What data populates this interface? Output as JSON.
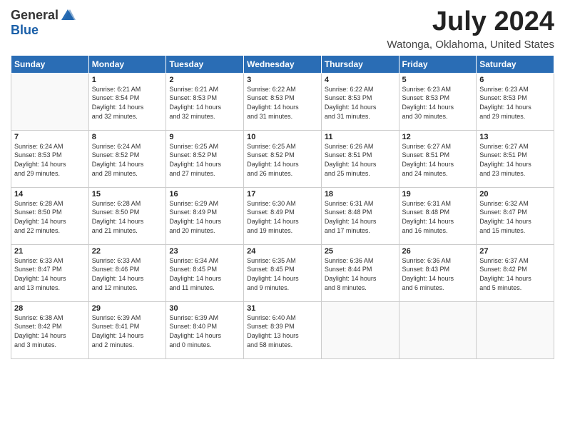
{
  "header": {
    "logo_general": "General",
    "logo_blue": "Blue",
    "month_year": "July 2024",
    "location": "Watonga, Oklahoma, United States"
  },
  "days_of_week": [
    "Sunday",
    "Monday",
    "Tuesday",
    "Wednesday",
    "Thursday",
    "Friday",
    "Saturday"
  ],
  "weeks": [
    [
      {
        "day": "",
        "info": ""
      },
      {
        "day": "1",
        "info": "Sunrise: 6:21 AM\nSunset: 8:54 PM\nDaylight: 14 hours\nand 32 minutes."
      },
      {
        "day": "2",
        "info": "Sunrise: 6:21 AM\nSunset: 8:53 PM\nDaylight: 14 hours\nand 32 minutes."
      },
      {
        "day": "3",
        "info": "Sunrise: 6:22 AM\nSunset: 8:53 PM\nDaylight: 14 hours\nand 31 minutes."
      },
      {
        "day": "4",
        "info": "Sunrise: 6:22 AM\nSunset: 8:53 PM\nDaylight: 14 hours\nand 31 minutes."
      },
      {
        "day": "5",
        "info": "Sunrise: 6:23 AM\nSunset: 8:53 PM\nDaylight: 14 hours\nand 30 minutes."
      },
      {
        "day": "6",
        "info": "Sunrise: 6:23 AM\nSunset: 8:53 PM\nDaylight: 14 hours\nand 29 minutes."
      }
    ],
    [
      {
        "day": "7",
        "info": "Sunrise: 6:24 AM\nSunset: 8:53 PM\nDaylight: 14 hours\nand 29 minutes."
      },
      {
        "day": "8",
        "info": "Sunrise: 6:24 AM\nSunset: 8:52 PM\nDaylight: 14 hours\nand 28 minutes."
      },
      {
        "day": "9",
        "info": "Sunrise: 6:25 AM\nSunset: 8:52 PM\nDaylight: 14 hours\nand 27 minutes."
      },
      {
        "day": "10",
        "info": "Sunrise: 6:25 AM\nSunset: 8:52 PM\nDaylight: 14 hours\nand 26 minutes."
      },
      {
        "day": "11",
        "info": "Sunrise: 6:26 AM\nSunset: 8:51 PM\nDaylight: 14 hours\nand 25 minutes."
      },
      {
        "day": "12",
        "info": "Sunrise: 6:27 AM\nSunset: 8:51 PM\nDaylight: 14 hours\nand 24 minutes."
      },
      {
        "day": "13",
        "info": "Sunrise: 6:27 AM\nSunset: 8:51 PM\nDaylight: 14 hours\nand 23 minutes."
      }
    ],
    [
      {
        "day": "14",
        "info": "Sunrise: 6:28 AM\nSunset: 8:50 PM\nDaylight: 14 hours\nand 22 minutes."
      },
      {
        "day": "15",
        "info": "Sunrise: 6:28 AM\nSunset: 8:50 PM\nDaylight: 14 hours\nand 21 minutes."
      },
      {
        "day": "16",
        "info": "Sunrise: 6:29 AM\nSunset: 8:49 PM\nDaylight: 14 hours\nand 20 minutes."
      },
      {
        "day": "17",
        "info": "Sunrise: 6:30 AM\nSunset: 8:49 PM\nDaylight: 14 hours\nand 19 minutes."
      },
      {
        "day": "18",
        "info": "Sunrise: 6:31 AM\nSunset: 8:48 PM\nDaylight: 14 hours\nand 17 minutes."
      },
      {
        "day": "19",
        "info": "Sunrise: 6:31 AM\nSunset: 8:48 PM\nDaylight: 14 hours\nand 16 minutes."
      },
      {
        "day": "20",
        "info": "Sunrise: 6:32 AM\nSunset: 8:47 PM\nDaylight: 14 hours\nand 15 minutes."
      }
    ],
    [
      {
        "day": "21",
        "info": "Sunrise: 6:33 AM\nSunset: 8:47 PM\nDaylight: 14 hours\nand 13 minutes."
      },
      {
        "day": "22",
        "info": "Sunrise: 6:33 AM\nSunset: 8:46 PM\nDaylight: 14 hours\nand 12 minutes."
      },
      {
        "day": "23",
        "info": "Sunrise: 6:34 AM\nSunset: 8:45 PM\nDaylight: 14 hours\nand 11 minutes."
      },
      {
        "day": "24",
        "info": "Sunrise: 6:35 AM\nSunset: 8:45 PM\nDaylight: 14 hours\nand 9 minutes."
      },
      {
        "day": "25",
        "info": "Sunrise: 6:36 AM\nSunset: 8:44 PM\nDaylight: 14 hours\nand 8 minutes."
      },
      {
        "day": "26",
        "info": "Sunrise: 6:36 AM\nSunset: 8:43 PM\nDaylight: 14 hours\nand 6 minutes."
      },
      {
        "day": "27",
        "info": "Sunrise: 6:37 AM\nSunset: 8:42 PM\nDaylight: 14 hours\nand 5 minutes."
      }
    ],
    [
      {
        "day": "28",
        "info": "Sunrise: 6:38 AM\nSunset: 8:42 PM\nDaylight: 14 hours\nand 3 minutes."
      },
      {
        "day": "29",
        "info": "Sunrise: 6:39 AM\nSunset: 8:41 PM\nDaylight: 14 hours\nand 2 minutes."
      },
      {
        "day": "30",
        "info": "Sunrise: 6:39 AM\nSunset: 8:40 PM\nDaylight: 14 hours\nand 0 minutes."
      },
      {
        "day": "31",
        "info": "Sunrise: 6:40 AM\nSunset: 8:39 PM\nDaylight: 13 hours\nand 58 minutes."
      },
      {
        "day": "",
        "info": ""
      },
      {
        "day": "",
        "info": ""
      },
      {
        "day": "",
        "info": ""
      }
    ]
  ]
}
